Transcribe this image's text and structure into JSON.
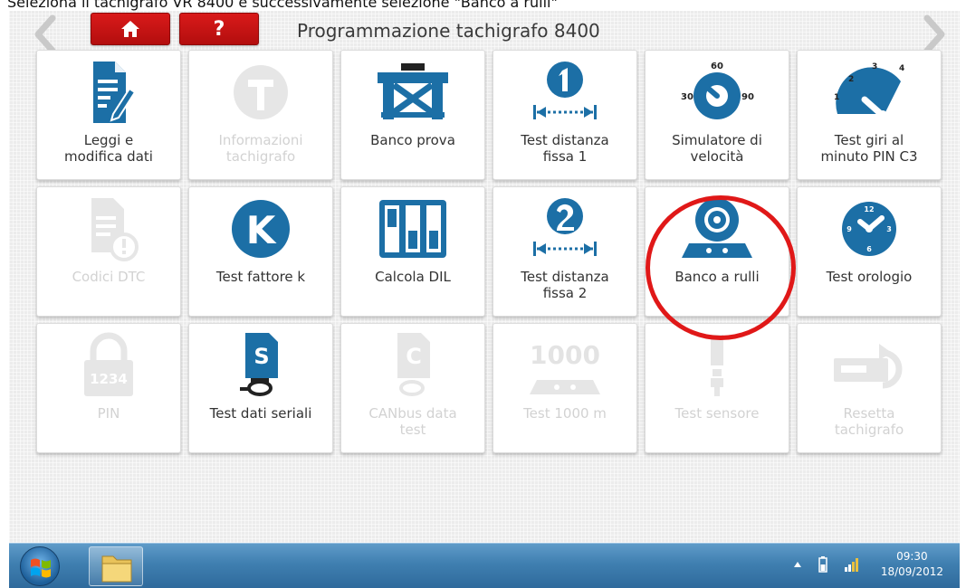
{
  "caption": "Seleziona il tachigrafo VR 8400 e successivamente selezione \"Banco a rulli\"",
  "header": {
    "title": "Programmazione tachigrafo 8400",
    "help_label": "?"
  },
  "tiles": [
    {
      "label": "Leggi e\nmodifica dati",
      "icon": "document-edit-icon",
      "enabled": true
    },
    {
      "label": "Informazioni\ntachigrafo",
      "icon": "tachograph-info-icon",
      "enabled": false
    },
    {
      "label": "Banco prova",
      "icon": "test-bench-icon",
      "enabled": true
    },
    {
      "label": "Test distanza\nfissa 1",
      "icon": "fixed-distance-1-icon",
      "enabled": true
    },
    {
      "label": "Simulatore di\nvelocità",
      "icon": "speed-simulator-icon",
      "enabled": true,
      "gauge_marks": [
        "30",
        "60",
        "90"
      ]
    },
    {
      "label": "Test giri al\nminuto PIN C3",
      "icon": "rpm-gauge-icon",
      "enabled": true,
      "gauge_marks": [
        "1",
        "2",
        "3",
        "4"
      ]
    },
    {
      "label": "Codici DTC",
      "icon": "dtc-codes-icon",
      "enabled": false
    },
    {
      "label": "Test fattore k",
      "icon": "k-factor-icon",
      "enabled": true,
      "glyph": "K"
    },
    {
      "label": "Calcola DIL",
      "icon": "dil-switches-icon",
      "enabled": true
    },
    {
      "label": "Test distanza\nfissa 2",
      "icon": "fixed-distance-2-icon",
      "enabled": true
    },
    {
      "label": "Banco a rulli",
      "icon": "roller-bench-icon",
      "enabled": true,
      "highlighted": true
    },
    {
      "label": "Test orologio",
      "icon": "clock-icon",
      "enabled": true,
      "clock_marks": [
        "12",
        "3",
        "6",
        "9"
      ]
    },
    {
      "label": "PIN",
      "icon": "pin-lock-icon",
      "enabled": false,
      "glyph": "1234"
    },
    {
      "label": "Test dati seriali",
      "icon": "serial-data-icon",
      "enabled": true,
      "glyph": "S"
    },
    {
      "label": "CANbus data\ntest",
      "icon": "canbus-icon",
      "enabled": false,
      "glyph": "C"
    },
    {
      "label": "Test 1000 m",
      "icon": "test-1000m-icon",
      "enabled": false,
      "glyph": "1000"
    },
    {
      "label": "Test sensore",
      "icon": "sensor-icon",
      "enabled": false
    },
    {
      "label": "Resetta\ntachigrafo",
      "icon": "reset-tachograph-icon",
      "enabled": false
    }
  ],
  "taskbar": {
    "time": "09:30",
    "date": "18/09/2012"
  },
  "colors": {
    "accent_blue": "#1c6fa6",
    "header_red": "#c8141a",
    "highlight_red": "#e01818"
  }
}
